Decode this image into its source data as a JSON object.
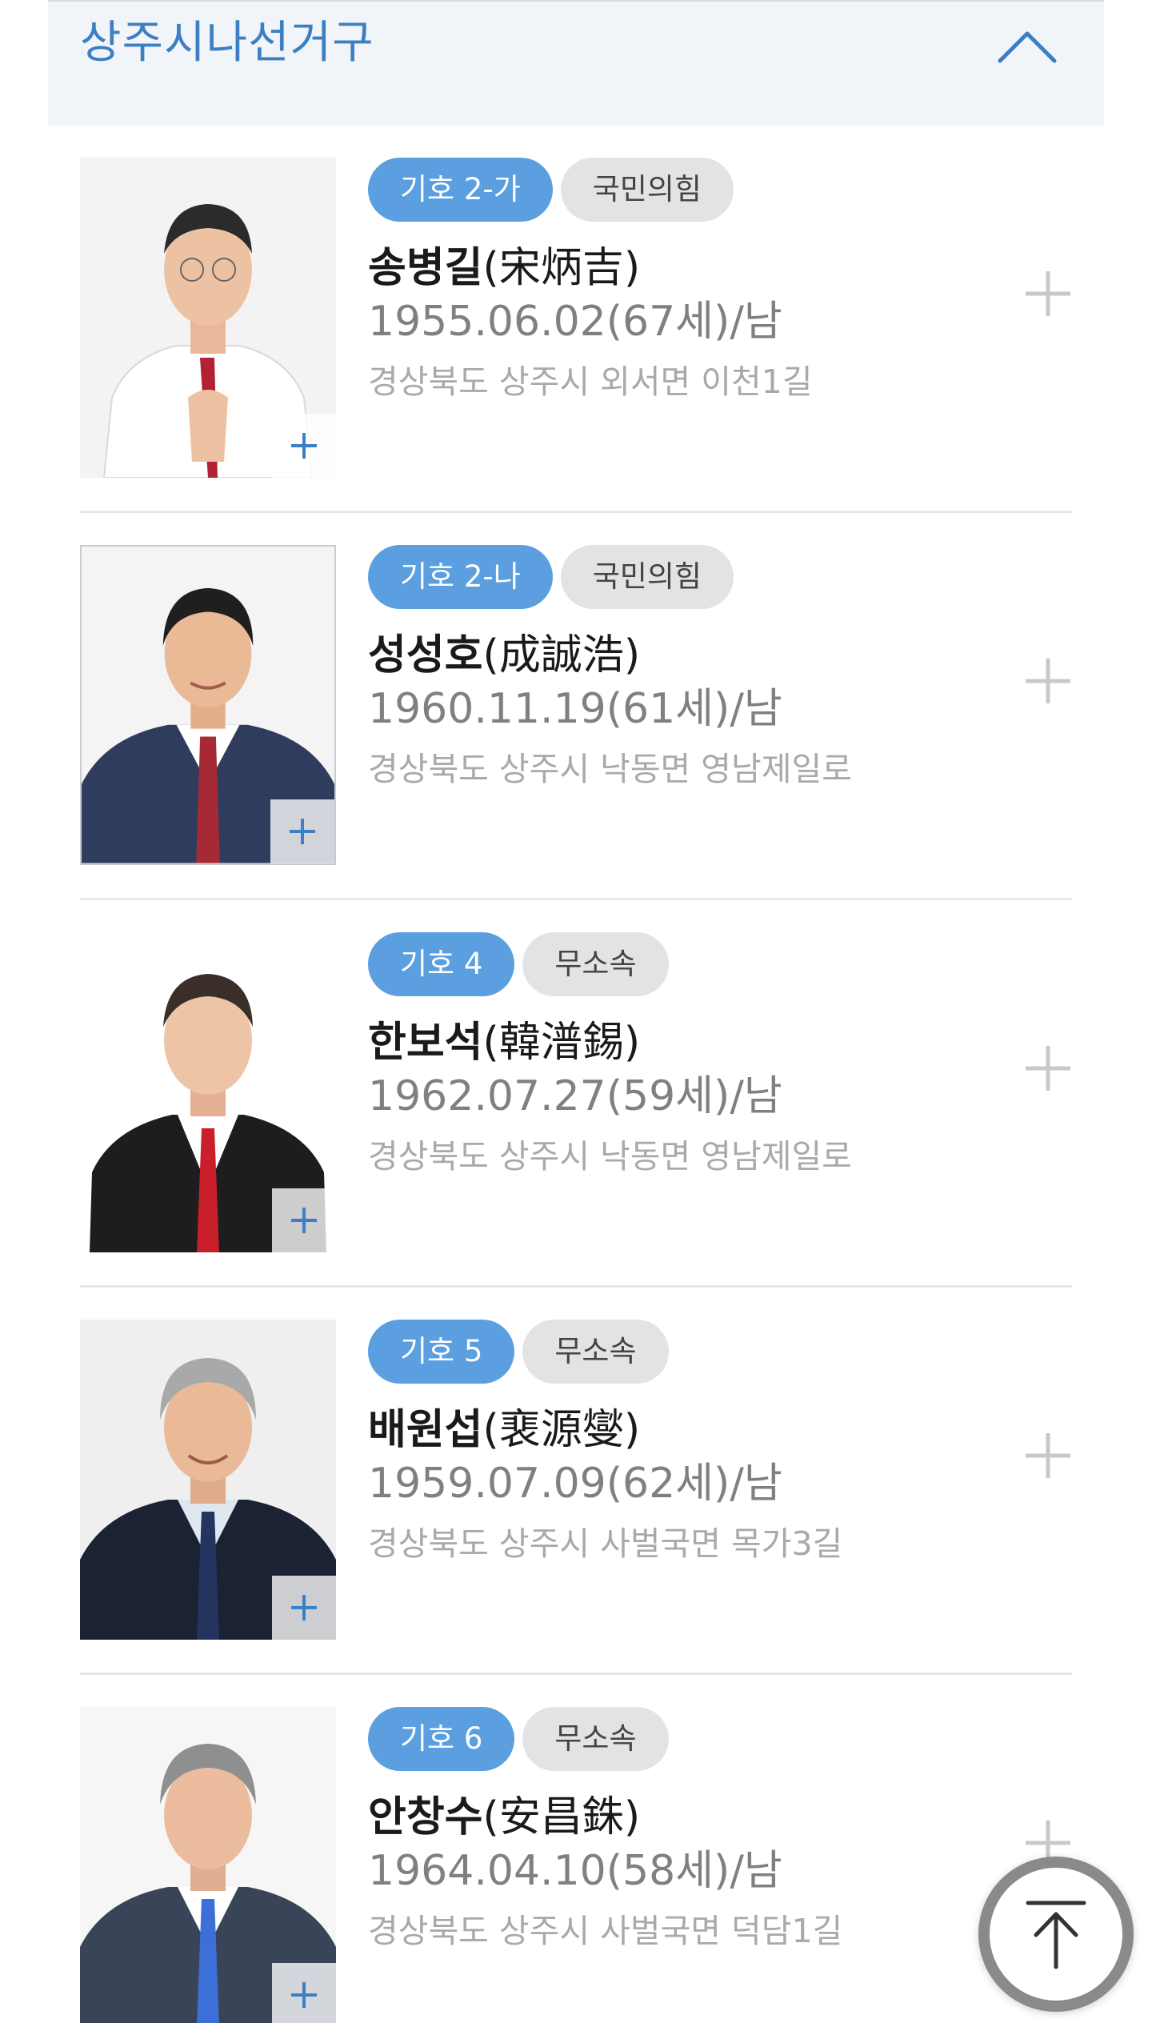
{
  "district": {
    "title": "상주시나선거구",
    "collapse_icon": "chevron-up-icon",
    "accent_color": "#3d7fc3"
  },
  "badge_colors": {
    "number_bg": "#5b9fe0",
    "party_bg": "#e3e3e5"
  },
  "candidates": [
    {
      "number": "기호 2-가",
      "party": "국민의힘",
      "name": "송병길",
      "hanja": "(宋炳吉)",
      "birth": "1955.06.02(67세)/남",
      "address": "경상북도 상주시 외서면 이천1길"
    },
    {
      "number": "기호 2-나",
      "party": "국민의힘",
      "name": "성성호",
      "hanja": "(成誠浩)",
      "birth": "1960.11.19(61세)/남",
      "address": "경상북도 상주시 낙동면 영남제일로"
    },
    {
      "number": "기호 4",
      "party": "무소속",
      "name": "한보석",
      "hanja": "(韓潽錫)",
      "birth": "1962.07.27(59세)/남",
      "address": "경상북도 상주시 낙동면 영남제일로"
    },
    {
      "number": "기호 5",
      "party": "무소속",
      "name": "배원섭",
      "hanja": "(裵源燮)",
      "birth": "1959.07.09(62세)/남",
      "address": "경상북도 상주시 사벌국면 목가3길"
    },
    {
      "number": "기호 6",
      "party": "무소속",
      "name": "안창수",
      "hanja": "(安昌銖)",
      "birth": "1964.04.10(58세)/남",
      "address": "경상북도 상주시 사벌국면 덕담1길"
    }
  ],
  "icons": {
    "expand": "plus-icon",
    "photo_zoom": "plus-icon",
    "scroll_top": "arrow-up-to-top-icon"
  }
}
